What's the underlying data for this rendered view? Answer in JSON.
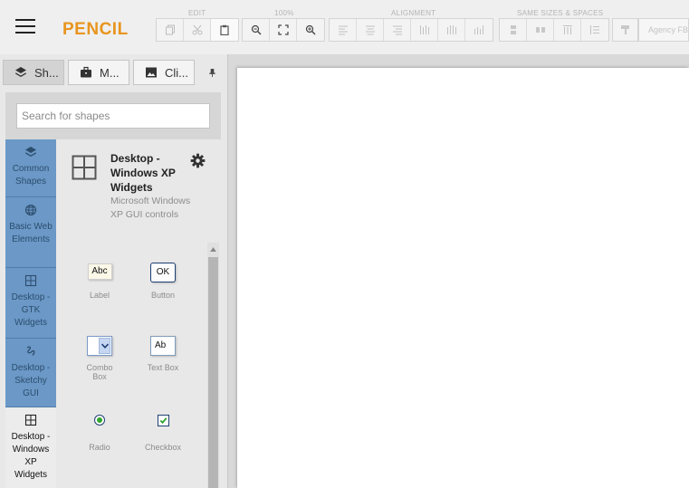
{
  "app": {
    "title": "PENCIL",
    "title_color": "#e8951e"
  },
  "toolbar": {
    "groups": [
      {
        "label": "EDIT",
        "buttons": [
          "copy-icon",
          "cut-icon",
          "paste-icon"
        ]
      },
      {
        "label": "100%",
        "buttons": [
          "zoom-out-icon",
          "fit-screen-icon",
          "zoom-in-icon"
        ]
      },
      {
        "label": "ALIGNMENT",
        "buttons": [
          "align-left-icon",
          "align-center-icon",
          "align-right-icon",
          "distribute-left-icon",
          "distribute-center-icon",
          "distribute-right-icon"
        ]
      },
      {
        "label": "SAME SIZES & SPACES",
        "buttons": [
          "same-width-icon",
          "same-height-icon",
          "same-h-spacing-icon",
          "same-v-spacing-icon"
        ]
      }
    ],
    "format_painter_icon": "format-painter-icon",
    "font_value": "Agency FB"
  },
  "panel": {
    "tabs": [
      {
        "label": "Sh...",
        "icon": "layers-icon",
        "active": true
      },
      {
        "label": "M...",
        "icon": "briefcase-icon",
        "active": false
      },
      {
        "label": "Cli...",
        "icon": "image-icon",
        "active": false
      }
    ],
    "pin_icon": "pin-icon",
    "search_placeholder": "Search for shapes",
    "categories": [
      {
        "label": "Common Shapes",
        "icon": "layers-icon"
      },
      {
        "label": "Basic Web Elements",
        "icon": "globe-icon"
      },
      {
        "label": "Desktop - GTK Widgets",
        "icon": "grid-icon"
      },
      {
        "label": "Desktop - Sketchy GUI",
        "icon": "squiggle-icon"
      },
      {
        "label": "Desktop - Windows XP Widgets",
        "icon": "grid-icon",
        "selected": true
      }
    ],
    "collection": {
      "title": "Desktop - Windows XP Widgets",
      "description": "Microsoft Windows XP GUI controls",
      "settings_icon": "gear-icon"
    },
    "shapes": [
      {
        "label": "Label",
        "preview": "Abc"
      },
      {
        "label": "Button",
        "preview": "OK"
      },
      {
        "label": "Combo Box",
        "preview": ""
      },
      {
        "label": "Text Box",
        "preview": "Ab"
      },
      {
        "label": "Radio",
        "preview": ""
      },
      {
        "label": "Checkbox",
        "preview": ""
      }
    ]
  },
  "colors": {
    "category_bg": "#6b98c6",
    "toolbar_bg": "#efefef",
    "canvas_bg": "#d9d9d9",
    "page_bg": "#ffffff"
  }
}
